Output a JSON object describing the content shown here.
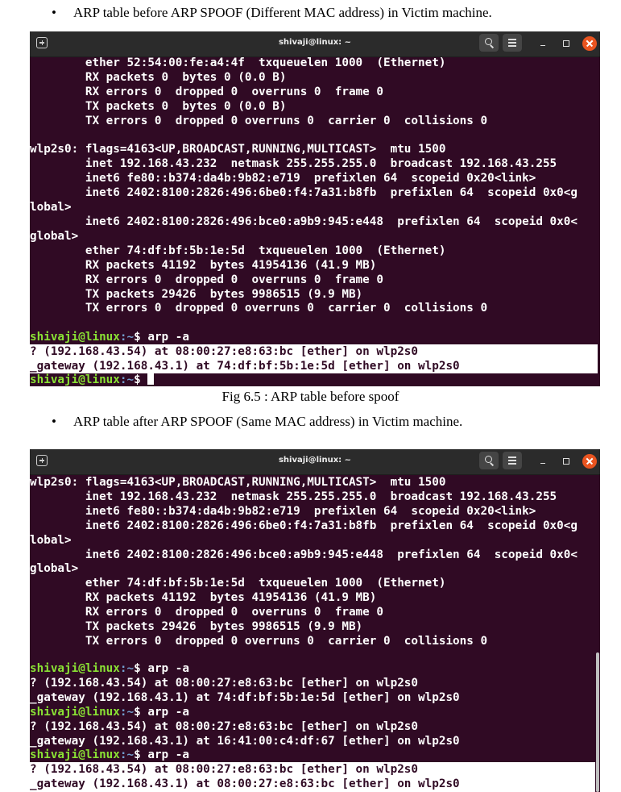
{
  "doc": {
    "bullet1": "ARP table before ARP SPOOF (Different MAC address) in Victim machine.",
    "caption1": "Fig 6.5 : ARP table before spoof",
    "bullet2": "ARP table after ARP SPOOF (Same MAC address) in Victim machine."
  },
  "terminal1": {
    "title": "shivaji@linux: ~",
    "lines": [
      "        ether 52:54:00:fe:a4:4f  txqueuelen 1000  (Ethernet)",
      "        RX packets 0  bytes 0 (0.0 B)",
      "        RX errors 0  dropped 0  overruns 0  frame 0",
      "        TX packets 0  bytes 0 (0.0 B)",
      "        TX errors 0  dropped 0 overruns 0  carrier 0  collisions 0",
      "",
      "wlp2s0: flags=4163<UP,BROADCAST,RUNNING,MULTICAST>  mtu 1500",
      "        inet 192.168.43.232  netmask 255.255.255.0  broadcast 192.168.43.255",
      "        inet6 fe80::b374:da4b:9b82:e719  prefixlen 64  scopeid 0x20<link>",
      "        inet6 2402:8100:2826:496:6be0:f4:7a31:b8fb  prefixlen 64  scopeid 0x0<g",
      "lobal>",
      "        inet6 2402:8100:2826:496:bce0:a9b9:945:e448  prefixlen 64  scopeid 0x0<",
      "global>",
      "        ether 74:df:bf:5b:1e:5d  txqueuelen 1000  (Ethernet)",
      "        RX packets 41192  bytes 41954136 (41.9 MB)",
      "        RX errors 0  dropped 0  overruns 0  frame 0",
      "        TX packets 29426  bytes 9986515 (9.9 MB)",
      "        TX errors 0  dropped 0 overruns 0  carrier 0  collisions 0",
      ""
    ],
    "prompt_user": "shivaji@linux",
    "prompt_path": ":~",
    "prompt_symbol": "$ ",
    "command": "arp -a",
    "arp_lines": [
      "? (192.168.43.54) at 08:00:27:e8:63:bc [ether] on wlp2s0",
      "_gateway (192.168.43.1) at 74:df:bf:5b:1e:5d [ether] on wlp2s0"
    ]
  },
  "terminal2": {
    "title": "shivaji@linux: ~",
    "lines": [
      "wlp2s0: flags=4163<UP,BROADCAST,RUNNING,MULTICAST>  mtu 1500",
      "        inet 192.168.43.232  netmask 255.255.255.0  broadcast 192.168.43.255",
      "        inet6 fe80::b374:da4b:9b82:e719  prefixlen 64  scopeid 0x20<link>",
      "        inet6 2402:8100:2826:496:6be0:f4:7a31:b8fb  prefixlen 64  scopeid 0x0<g",
      "lobal>",
      "        inet6 2402:8100:2826:496:bce0:a9b9:945:e448  prefixlen 64  scopeid 0x0<",
      "global>",
      "        ether 74:df:bf:5b:1e:5d  txqueuelen 1000  (Ethernet)",
      "        RX packets 41192  bytes 41954136 (41.9 MB)",
      "        RX errors 0  dropped 0  overruns 0  frame 0",
      "        TX packets 29426  bytes 9986515 (9.9 MB)",
      "        TX errors 0  dropped 0 overruns 0  carrier 0  collisions 0",
      ""
    ],
    "prompt_user": "shivaji@linux",
    "prompt_path": ":~",
    "prompt_symbol": "$ ",
    "command": "arp -a",
    "block1": [
      "? (192.168.43.54) at 08:00:27:e8:63:bc [ether] on wlp2s0",
      "_gateway (192.168.43.1) at 74:df:bf:5b:1e:5d [ether] on wlp2s0"
    ],
    "block2": [
      "? (192.168.43.54) at 08:00:27:e8:63:bc [ether] on wlp2s0",
      "_gateway (192.168.43.1) at 16:41:00:c4:df:67 [ether] on wlp2s0"
    ],
    "block3": [
      "? (192.168.43.54) at 08:00:27:e8:63:bc [ether] on wlp2s0",
      "_gateway (192.168.43.1) at 08:00:27:e8:63:bc [ether] on wlp2s0"
    ]
  },
  "icons": [
    "new-tab-icon",
    "search-icon",
    "menu-icon",
    "minimize-icon",
    "maximize-icon",
    "close-icon"
  ],
  "colors": {
    "terminal_bg": "#300a24",
    "titlebar_bg": "#2b2b2b",
    "prompt_user": "#8ae234",
    "prompt_path": "#729fcf",
    "close_button": "#e95420"
  }
}
